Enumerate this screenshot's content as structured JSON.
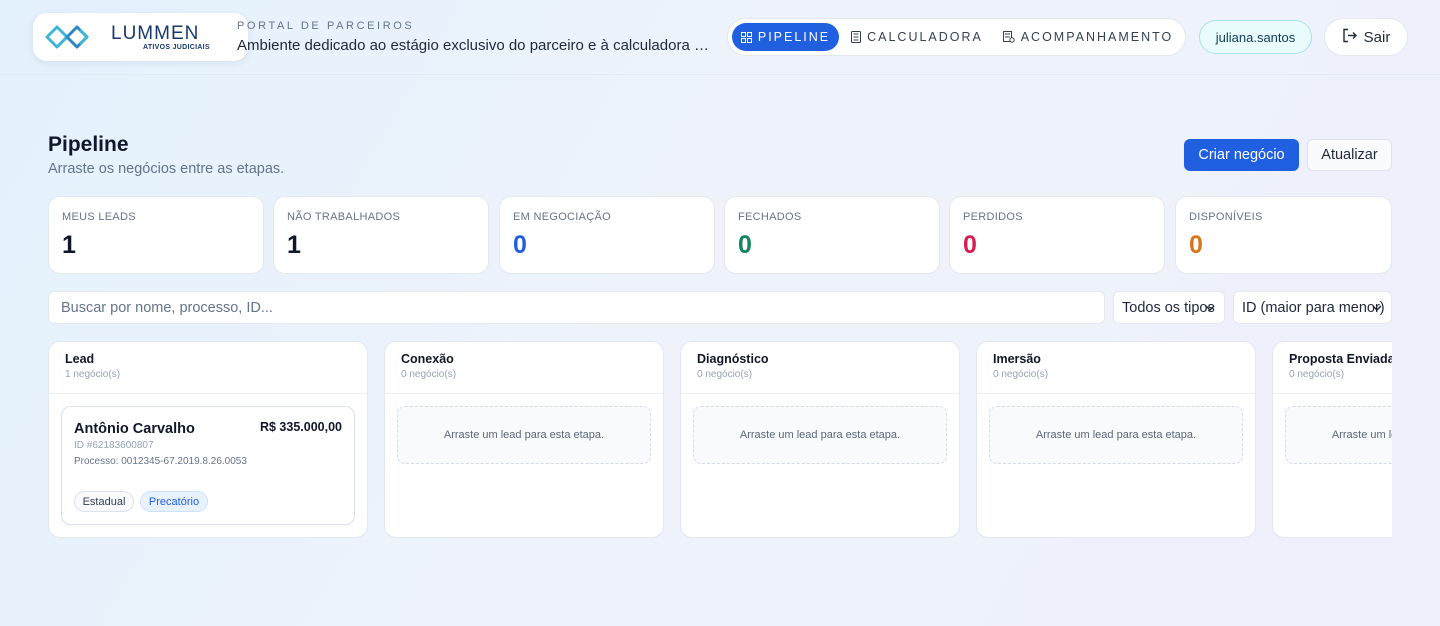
{
  "brand": {
    "name": "LUMMEN",
    "tagline": "ATIVOS JUDICIAIS",
    "kicker": "PORTAL DE PARCEIROS",
    "description": "Ambiente dedicado ao estágio exclusivo do parceiro e à calculadora de negócios"
  },
  "nav": {
    "tabs": [
      {
        "label": "PIPELINE",
        "icon": "grid-icon",
        "active": true
      },
      {
        "label": "CALCULADORA",
        "icon": "calculator-icon",
        "active": false
      },
      {
        "label": "ACOMPANHAMENTO",
        "icon": "tracking-icon",
        "active": false
      }
    ],
    "user": "juliana.santos",
    "logout_label": "Sair"
  },
  "page": {
    "title": "Pipeline",
    "subtitle": "Arraste os negócios entre as etapas.",
    "create_button": "Criar negócio",
    "refresh_button": "Atualizar"
  },
  "stats": [
    {
      "label": "MEUS LEADS",
      "value": "1",
      "color": "#0f172a"
    },
    {
      "label": "NÃO TRABALHADOS",
      "value": "1",
      "color": "#0f172a"
    },
    {
      "label": "EM NEGOCIAÇÃO",
      "value": "0",
      "color": "#1f5fe0"
    },
    {
      "label": "FECHADOS",
      "value": "0",
      "color": "#11855c"
    },
    {
      "label": "PERDIDOS",
      "value": "0",
      "color": "#d61f4f"
    },
    {
      "label": "DISPONÍVEIS",
      "value": "0",
      "color": "#d8761b"
    }
  ],
  "filters": {
    "search_placeholder": "Buscar por nome, processo, ID...",
    "type_select": "Todos os tipos",
    "sort_select": "ID (maior para menor)"
  },
  "columns": [
    {
      "title": "Lead",
      "count": "1 negócio(s)"
    },
    {
      "title": "Conexão",
      "count": "0 negócio(s)",
      "empty": "Arraste um lead para esta etapa."
    },
    {
      "title": "Diagnóstico",
      "count": "0 negócio(s)",
      "empty": "Arraste um lead para esta etapa."
    },
    {
      "title": "Imersão",
      "count": "0 negócio(s)",
      "empty": "Arraste um lead para esta etapa."
    },
    {
      "title": "Proposta Enviada",
      "count": "0 negócio(s)",
      "empty": "Arraste um lead para esta etapa."
    }
  ],
  "lead_card": {
    "name": "Antônio Carvalho",
    "amount": "R$ 335.000,00",
    "id": "ID #62183600807",
    "process": "Processo: 0012345-67.2019.8.26.0053",
    "tags": [
      "Estadual",
      "Precatório"
    ]
  }
}
